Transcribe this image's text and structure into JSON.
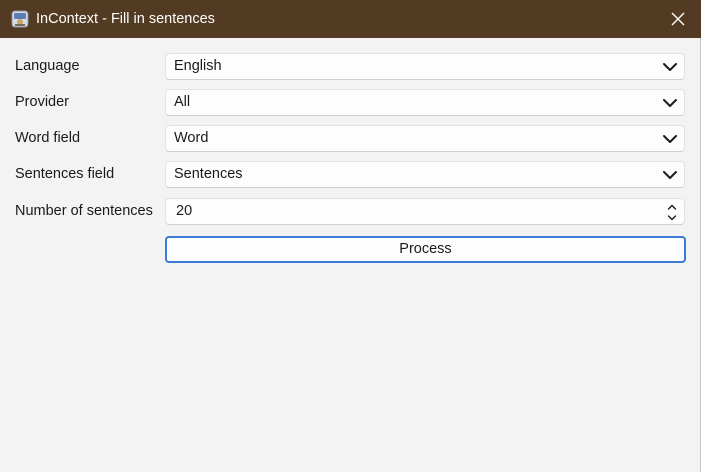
{
  "window": {
    "title": "InContext - Fill in sentences",
    "app_icon": "app-icon",
    "close_icon": "close-icon",
    "titlebar_color": "#533a22"
  },
  "form": {
    "language": {
      "label": "Language",
      "value": "English"
    },
    "provider": {
      "label": "Provider",
      "value": "All"
    },
    "word_field": {
      "label": "Word field",
      "value": "Word"
    },
    "sentences_field": {
      "label": "Sentences field",
      "value": "Sentences"
    },
    "number_of_sentences": {
      "label": "Number of sentences",
      "value": "20"
    }
  },
  "actions": {
    "process_label": "Process",
    "focus_color": "#3b7ad6"
  }
}
